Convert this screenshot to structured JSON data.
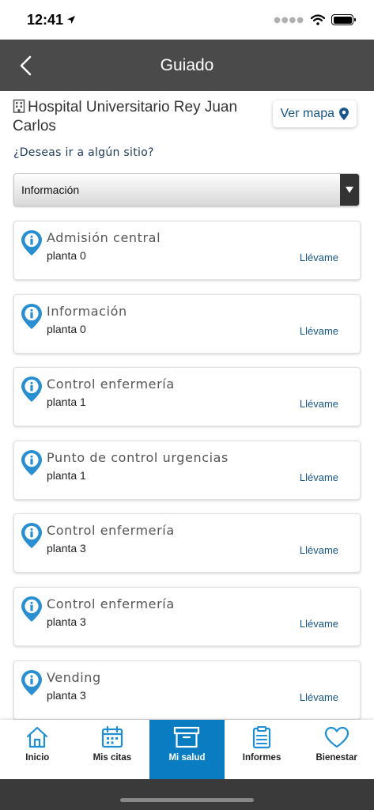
{
  "status": {
    "time": "12:41"
  },
  "header": {
    "title": "Guiado"
  },
  "hospital": {
    "name": "Hospital Universitario Rey Juan Carlos",
    "map_button": "Ver mapa"
  },
  "question": "¿Deseas ir a algún sitio?",
  "select": {
    "value": "Información"
  },
  "locations": [
    {
      "title": "Admisión central",
      "floor": "planta 0",
      "action": "Llévame"
    },
    {
      "title": "Información",
      "floor": "planta 0",
      "action": "Llévame"
    },
    {
      "title": "Control enfermería",
      "floor": "planta 1",
      "action": "Llévame"
    },
    {
      "title": "Punto de control urgencias",
      "floor": "planta 1",
      "action": "Llévame"
    },
    {
      "title": "Control enfermería",
      "floor": "planta 3",
      "action": "Llévame"
    },
    {
      "title": "Control enfermería",
      "floor": "planta 3",
      "action": "Llévame"
    },
    {
      "title": "Vending",
      "floor": "planta 3",
      "action": "Llévame"
    }
  ],
  "nav": {
    "items": [
      {
        "label": "Inicio",
        "icon": "home-icon"
      },
      {
        "label": "Mis citas",
        "icon": "calendar-icon"
      },
      {
        "label": "Mi salud",
        "icon": "archive-box-icon",
        "active": true
      },
      {
        "label": "Informes",
        "icon": "clipboard-icon"
      },
      {
        "label": "Bienestar",
        "icon": "heart-icon"
      }
    ]
  },
  "colors": {
    "header_bg": "#4a4a4a",
    "accent": "#0a7cc1",
    "link": "#16568a",
    "pin": "#2a8fd0"
  }
}
